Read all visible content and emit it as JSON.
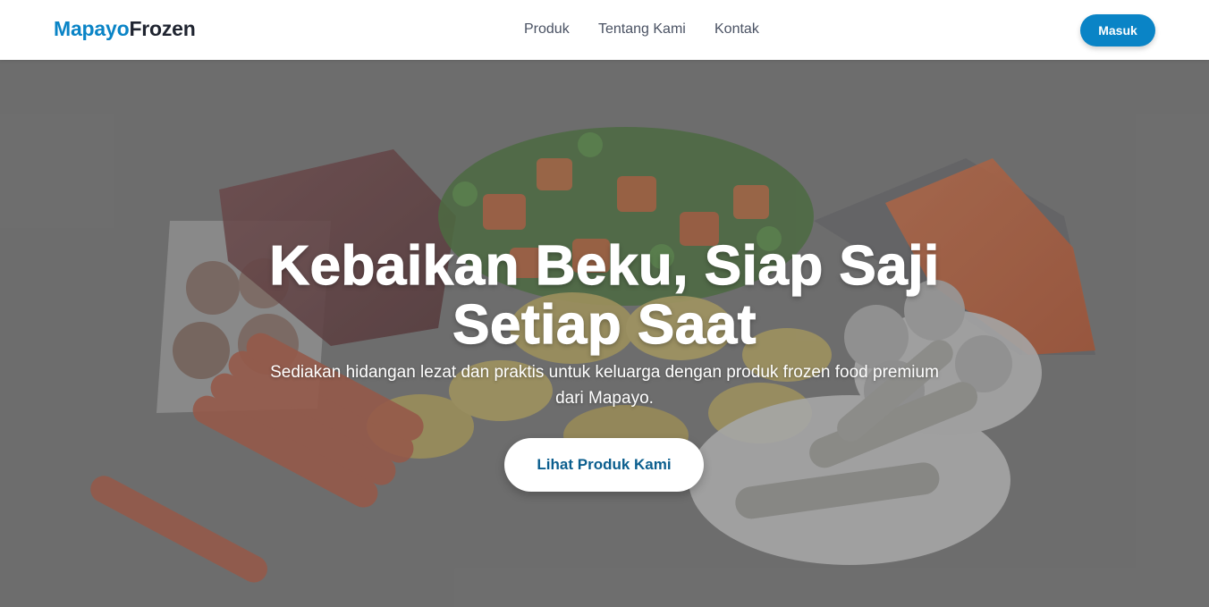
{
  "brand": {
    "part1": "Mapayo",
    "part2": "Frozen"
  },
  "nav": {
    "links": [
      "Produk",
      "Tentang Kami",
      "Kontak"
    ],
    "login_label": "Masuk"
  },
  "hero": {
    "title": "Kebaikan Beku, Siap Saji Setiap Saat",
    "subtitle": "Sediakan hidangan lezat dan praktis untuk keluarga dengan produk frozen food premium dari Mapayo.",
    "cta_label": "Lihat Produk Kami",
    "image_description_icon": "frozen-food-hero-image"
  },
  "colors": {
    "brand_primary": "#0a84c6",
    "brand_dark": "#1f2430",
    "nav_text": "#4a5263",
    "cta_text": "#0b5e8e"
  }
}
